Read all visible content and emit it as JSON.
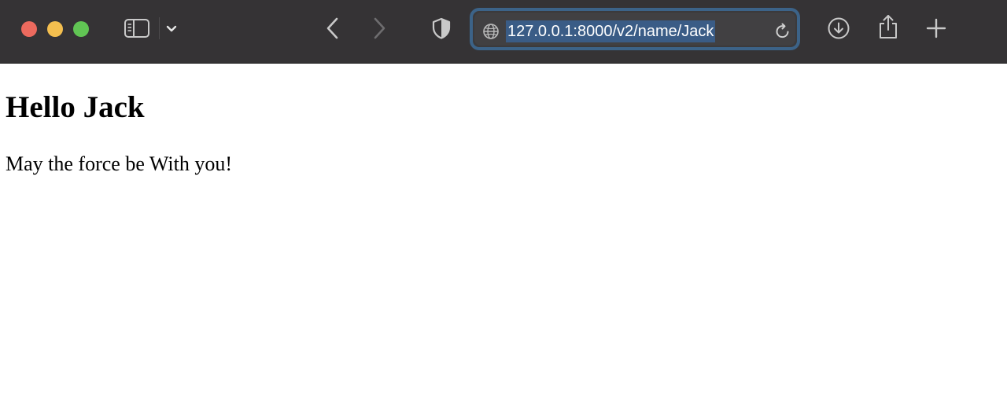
{
  "browser": {
    "address_bar": {
      "url": "127.0.0.1:8000/v2/name/Jack"
    },
    "icons": {
      "sidebar": "sidebar-icon",
      "sidebar_menu": "chevron-down-icon",
      "back": "chevron-left-icon",
      "forward": "chevron-right-icon",
      "privacy": "shield-icon",
      "site": "globe-icon",
      "reload": "reload-icon",
      "downloads": "download-icon",
      "share": "share-icon",
      "new_tab": "plus-icon"
    },
    "colors": {
      "toolbar": "#353335",
      "address_focus_ring": "#3c6388",
      "url_selection": "#3a5c86",
      "close": "#ec6a5e",
      "minimize": "#f4bf4f",
      "maximize": "#61c554"
    }
  },
  "page": {
    "heading": "Hello Jack",
    "paragraph": "May the force be With you!"
  }
}
